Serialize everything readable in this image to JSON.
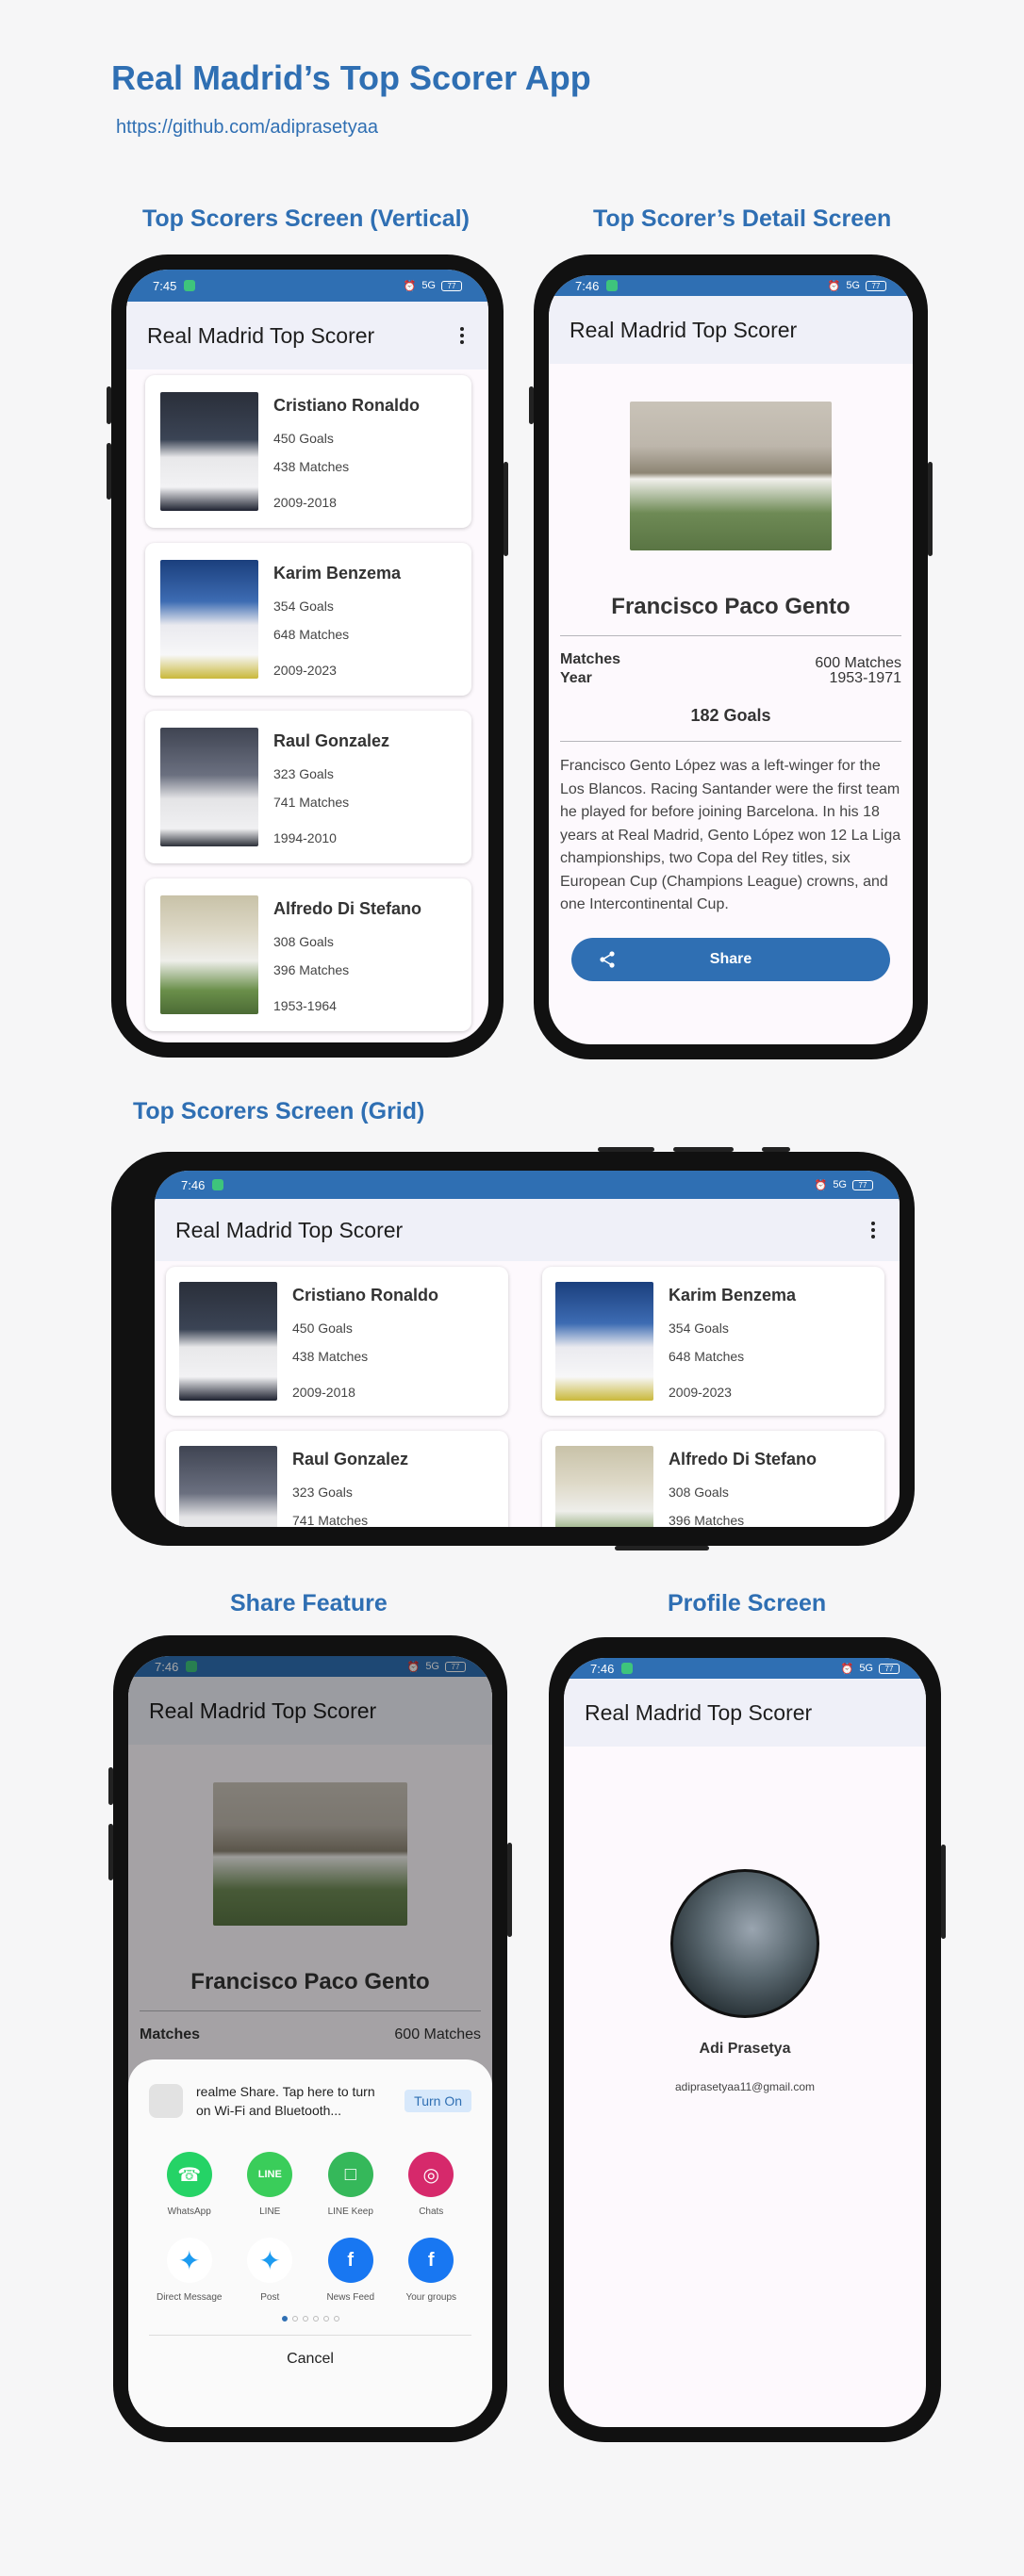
{
  "page": {
    "title": "Real Madrid’s Top Scorer App",
    "link": "https://github.com/adiprasetyaa"
  },
  "sections": {
    "vertical": "Top Scorers Screen (Vertical)",
    "detail": "Top Scorer’s Detail Screen",
    "grid": "Top Scorers Screen (Grid)",
    "share": "Share Feature",
    "profile": "Profile Screen"
  },
  "status": {
    "time_vertical": "7:45",
    "time_other": "7:46",
    "battery": "77",
    "signal": "5G"
  },
  "app": {
    "title": "Real Madrid Top Scorer"
  },
  "players": [
    {
      "name": "Cristiano Ronaldo",
      "goals": "450 Goals",
      "matches": "438 Matches",
      "years": "2009-2018"
    },
    {
      "name": "Karim Benzema",
      "goals": "354 Goals",
      "matches": "648 Matches",
      "years": "2009-2023"
    },
    {
      "name": "Raul Gonzalez",
      "goals": "323 Goals",
      "matches": "741 Matches",
      "years": "1994-2010"
    },
    {
      "name": "Alfredo Di Stefano",
      "goals": "308 Goals",
      "matches": "396 Matches",
      "years": "1953-1964"
    }
  ],
  "detail": {
    "name": "Francisco Paco Gento",
    "matches_label": "Matches",
    "year_label": "Year",
    "matches": "600 Matches",
    "years": "1953-1971",
    "goals": "182 Goals",
    "description": "Francisco Gento López was a left-winger for the Los Blancos. Racing Santander were the first team he played for before joining Barcelona. In his 18 years at Real Madrid, Gento López won 12 La Liga championships, two Copa del Rey titles, six European Cup (Champions League) crowns, and one Intercontinental Cup.",
    "share_label": "Share"
  },
  "share_sheet": {
    "realme_text": "realme Share. Tap here to turn on Wi-Fi and Bluetooth...",
    "turn_on": "Turn On",
    "apps": [
      {
        "label": "WhatsApp",
        "icon": "whatsapp-icon",
        "color": "#25d366",
        "glyph": "☎"
      },
      {
        "label": "LINE",
        "icon": "line-icon",
        "color": "#3acd5a",
        "glyph": "LINE"
      },
      {
        "label": "LINE Keep",
        "icon": "line-keep-icon",
        "color": "#35b85a",
        "glyph": "□"
      },
      {
        "label": "Chats",
        "icon": "instagram-icon",
        "color": "#d6296b",
        "glyph": "◎"
      },
      {
        "label": "Direct Message",
        "icon": "twitter-icon",
        "color": "#ffffff",
        "glyph": "✦"
      },
      {
        "label": "Post",
        "icon": "twitter-icon",
        "color": "#ffffff",
        "glyph": "✦"
      },
      {
        "label": "News Feed",
        "icon": "facebook-icon",
        "color": "#1877f2",
        "glyph": "f"
      },
      {
        "label": "Your groups",
        "icon": "facebook-icon",
        "color": "#1877f2",
        "glyph": "f"
      }
    ],
    "cancel": "Cancel",
    "dim_matches": "600 Matches",
    "dim_matches_label": "Matches"
  },
  "profile": {
    "name": "Adi Prasetya",
    "email": "adiprasetyaa11@gmail.com"
  },
  "colors": {
    "accent": "#2f6fb3",
    "appbar": "#eff0f8"
  }
}
